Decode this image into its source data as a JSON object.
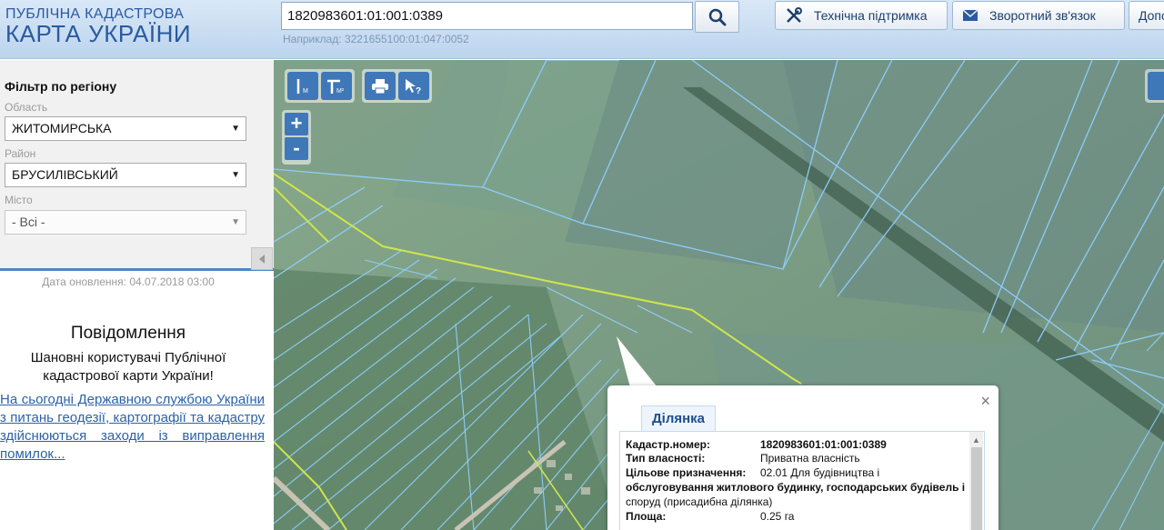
{
  "header": {
    "logo_line1": "ПУБЛІЧНА КАДАСТРОВА",
    "logo_line2": "КАРТА УКРАЇНИ",
    "search_value": "1820983601:01:001:0389",
    "search_hint": "Наприклад: 3221655100:01:047:0052",
    "support_label": "Технічна підтримка",
    "feedback_label": "Зворотний зв'язок",
    "extra_label": "Допо"
  },
  "sidebar": {
    "filter_title": "Фільтр по регіону",
    "region_label": "Область",
    "region_value": "ЖИТОМИРСЬКА",
    "district_label": "Район",
    "district_value": "БРУСИЛІВСЬКИЙ",
    "city_label": "Місто",
    "city_value": "- Всі -",
    "update_date": "Дата оновлення: 04.07.2018 03:00",
    "notice_title": "Повідомлення",
    "notice_text": "Шановні користувачі Публічної кадастрової карти України!",
    "notice_link": "На сьогодні Державною службою України з питань геодезії, картографії та кадастру здійснюються заходи із виправлення помилок..."
  },
  "map": {
    "zoom_in": "+",
    "zoom_out": "-",
    "popup": {
      "tab": "Ділянка",
      "close": "×",
      "rows": [
        {
          "key": "Кадастр.номер:",
          "value": "1820983601:01:001:0389"
        },
        {
          "key": "Тип власності:",
          "value": "Приватна власність"
        },
        {
          "key": "Цільове призначення:",
          "value": "02.01 Для будівництва і"
        },
        {
          "key": "",
          "value": "обслуговування житлового будинку, господарських будівель і"
        },
        {
          "key": "",
          "value": "споруд (присадибна ділянка)"
        },
        {
          "key": "Площа:",
          "value": "0.25 га"
        }
      ]
    }
  },
  "colors": {
    "header_bg": "#c8dcf1",
    "accent": "#3f78b8",
    "link": "#2c62a8",
    "parcel_outline": "#8fd0ff",
    "boundary_line": "#cfe54a"
  }
}
